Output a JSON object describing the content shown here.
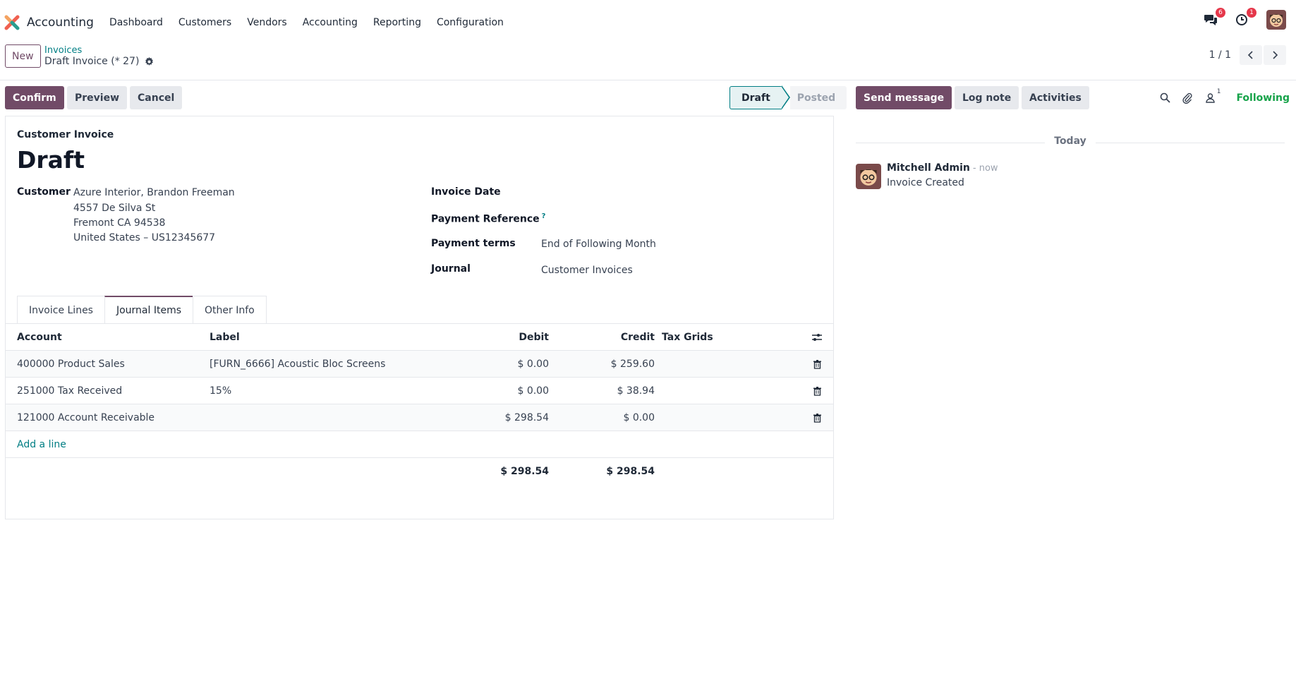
{
  "app": {
    "name": "Accounting",
    "menu": [
      "Dashboard",
      "Customers",
      "Vendors",
      "Accounting",
      "Reporting",
      "Configuration"
    ],
    "badges": {
      "messages": "6",
      "activities": "1"
    }
  },
  "control_panel": {
    "new_label": "New",
    "breadcrumb": "Invoices",
    "record_title": "Draft Invoice (* 27)",
    "pager": "1 / 1"
  },
  "statusbar": {
    "confirm": "Confirm",
    "preview": "Preview",
    "cancel": "Cancel",
    "stages": {
      "draft": "Draft",
      "posted": "Posted"
    }
  },
  "form": {
    "doc_type": "Customer Invoice",
    "state": "Draft",
    "customer_label": "Customer",
    "customer_lines": [
      "Azure Interior, Brandon Freeman",
      "4557 De Silva St",
      "Fremont CA 94538",
      "United States – US12345677"
    ],
    "invoice_date_label": "Invoice Date",
    "payment_reference_label": "Payment Reference",
    "payment_reference_help": "?",
    "payment_terms_label": "Payment terms",
    "payment_terms_value": "End of Following Month",
    "journal_label": "Journal",
    "journal_value": "Customer Invoices"
  },
  "tabs": [
    {
      "label": "Invoice Lines",
      "active": false
    },
    {
      "label": "Journal Items",
      "active": true
    },
    {
      "label": "Other Info",
      "active": false
    }
  ],
  "journal_items": {
    "headers": {
      "account": "Account",
      "label": "Label",
      "debit": "Debit",
      "credit": "Credit",
      "tax_grids": "Tax Grids"
    },
    "rows": [
      {
        "account": "400000 Product Sales",
        "label": "[FURN_6666] Acoustic Bloc Screens",
        "debit": "$ 0.00",
        "credit": "$ 259.60"
      },
      {
        "account": "251000 Tax Received",
        "label": "15%",
        "debit": "$ 0.00",
        "credit": "$ 38.94"
      },
      {
        "account": "121000 Account Receivable",
        "label": "",
        "debit": "$ 298.54",
        "credit": "$ 0.00"
      }
    ],
    "add_line": "Add a line",
    "total_debit": "$ 298.54",
    "total_credit": "$ 298.54"
  },
  "chatter": {
    "send_message": "Send message",
    "log_note": "Log note",
    "activities": "Activities",
    "followers_count": "1",
    "following": "Following",
    "date_separator": "Today",
    "messages": [
      {
        "author": "Mitchell Admin",
        "time": "- now",
        "body": "Invoice Created"
      }
    ]
  }
}
